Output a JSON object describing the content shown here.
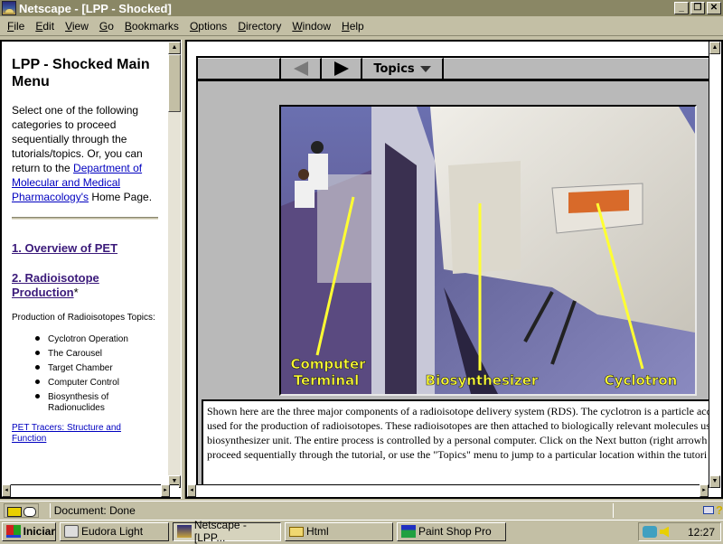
{
  "window": {
    "title": "Netscape - [LPP - Shocked]",
    "controls": {
      "minimize": "_",
      "restore": "❐",
      "close": "✕"
    }
  },
  "menubar": [
    {
      "label": "File",
      "accel": "F",
      "rest": "ile"
    },
    {
      "label": "Edit",
      "accel": "E",
      "rest": "dit"
    },
    {
      "label": "View",
      "accel": "V",
      "rest": "iew"
    },
    {
      "label": "Go",
      "accel": "G",
      "rest": "o"
    },
    {
      "label": "Bookmarks",
      "accel": "B",
      "rest": "ookmarks"
    },
    {
      "label": "Options",
      "accel": "O",
      "rest": "ptions"
    },
    {
      "label": "Directory",
      "accel": "D",
      "rest": "irectory"
    },
    {
      "label": "Window",
      "accel": "W",
      "rest": "indow"
    },
    {
      "label": "Help",
      "accel": "H",
      "rest": "elp"
    }
  ],
  "left_frame": {
    "title": "LPP - Shocked Main Menu",
    "intro_before": "Select one of the following categories to proceed sequentially through the tutorials/topics. Or, you can return to the ",
    "intro_link": "Department of Molecular and Medical Pharmacology's",
    "intro_after": " Home Page.",
    "nav1": "1. Overview of PET",
    "nav2": "2. Radioisotope Production",
    "nav2_suffix": "*",
    "sub_heading": "Production of Radioisotopes Topics:",
    "topics": [
      "Cyclotron Operation",
      "The Carousel",
      "Target Chamber",
      "Computer Control",
      "Biosynthesis of Radionuclides"
    ],
    "tracers_link": "PET Tracers: Structure and Function"
  },
  "toolbar": {
    "back_label": "Back",
    "next_label": "Next",
    "topics_label": "Topics"
  },
  "photo": {
    "labels": {
      "terminal_line1": "Computer",
      "terminal_line2": "Terminal",
      "biosynth": "Biosynthesizer",
      "cyclotron": "Cyclotron"
    },
    "label_color": "#ffff33"
  },
  "description": {
    "lines": [
      "Shown here are the three major components of a radioisotope delivery system (RDS). The cyclotron is a particle acc",
      "used for the production of radioisotopes. These radioisotopes are then attached to biologically relevant molecules usi",
      "biosynthesizer unit. The entire process is controlled by a personal computer. Click on the Next button (right arrowh",
      "proceed sequentially through the tutorial, or use the \"Topics\" menu to jump to a particular location within the tutori"
    ]
  },
  "statusbar": {
    "text": "Document: Done",
    "help_glyph": "?"
  },
  "taskbar": {
    "start_label": "Iniciar",
    "tasks": [
      {
        "label": "Eudora Light"
      },
      {
        "label": "Netscape - [LPP..."
      },
      {
        "label": "Html"
      },
      {
        "label": "Paint Shop Pro"
      }
    ],
    "clock": "12:27"
  }
}
